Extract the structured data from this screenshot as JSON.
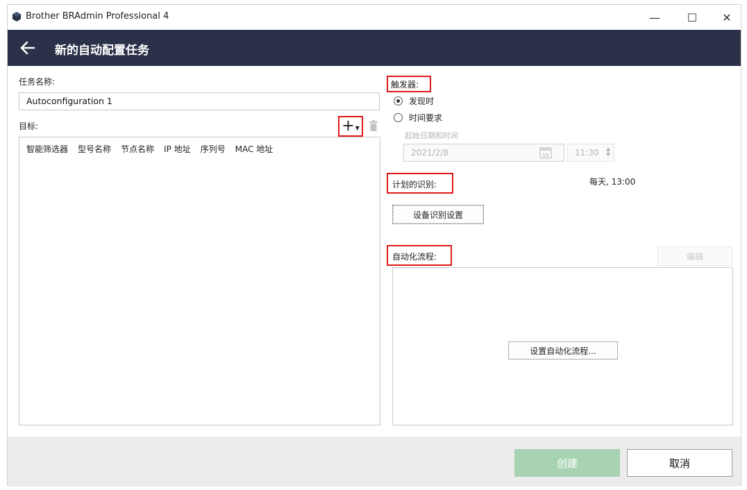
{
  "window": {
    "title": "Brother BRAdmin Professional 4",
    "minimize": "—",
    "maximize": "☐",
    "close": "✕"
  },
  "header": {
    "title": "新的自动配置任务"
  },
  "task": {
    "name_label": "任务名称:",
    "name_value": "Autoconfiguration 1"
  },
  "targets": {
    "label": "目标:",
    "add_symbol": "+",
    "columns": [
      "智能筛选器",
      "型号名称",
      "节点名称",
      "IP 地址",
      "序列号",
      "MAC 地址"
    ]
  },
  "trigger": {
    "label": "触发器:",
    "options": [
      {
        "label": "发现时",
        "selected": true
      },
      {
        "label": "时间要求",
        "selected": false
      }
    ],
    "start_label": "起始日期和时间",
    "date_value": "2021/2/8",
    "calendar_day": "15",
    "time_value": "11:30"
  },
  "schedule": {
    "label": "计划的识别:",
    "summary": "每天, 13:00",
    "settings_button": "设备识别设置"
  },
  "automation": {
    "label": "自动化流程:",
    "edit_button": "编辑",
    "setup_button": "设置自动化流程..."
  },
  "footer": {
    "create_button": "创建",
    "cancel_button": "取消"
  },
  "colors": {
    "header_bg": "#2b3148",
    "highlight_red": "#e01818",
    "create_disabled": "#a8d3b2"
  }
}
